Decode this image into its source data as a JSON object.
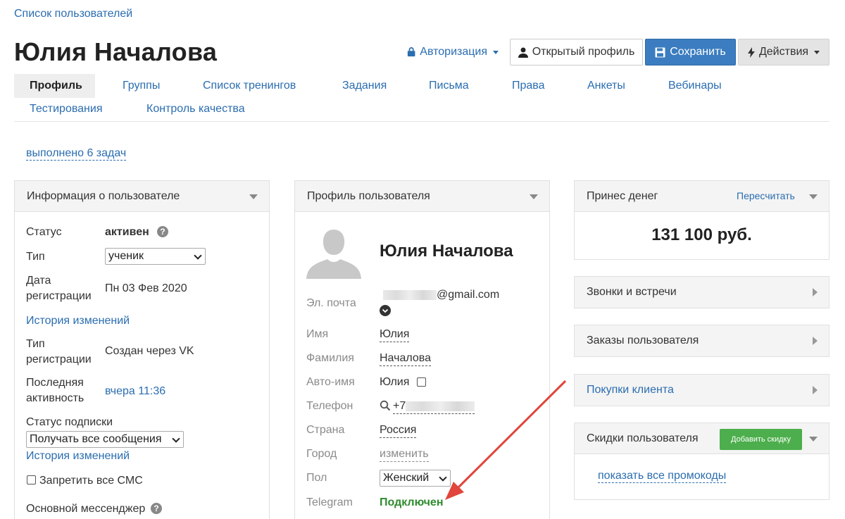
{
  "breadcrumb": "Список пользователей",
  "page_title": "Юлия Началова",
  "toolbar": {
    "auth_label": "Авторизация",
    "open_profile_label": "Открытый профиль",
    "save_label": "Сохранить",
    "actions_label": "Действия"
  },
  "tabs": [
    {
      "label": "Профиль",
      "active": true
    },
    {
      "label": "Группы"
    },
    {
      "label": "Список тренингов"
    },
    {
      "label": "Задания"
    },
    {
      "label": "Письма"
    },
    {
      "label": "Права"
    },
    {
      "label": "Анкеты"
    },
    {
      "label": "Вебинары"
    },
    {
      "label": "Тестирования"
    },
    {
      "label": "Контроль качества"
    }
  ],
  "tasks_link": "выполнено 6 задач",
  "user_info": {
    "title": "Информация о пользователе",
    "status_label": "Статус",
    "status_value": "активен",
    "type_label": "Тип",
    "type_value": "ученик",
    "reg_date_label_1": "Дата",
    "reg_date_label_2": "регистрации",
    "reg_date_value": "Пн 03 Фев 2020",
    "history_link_1": "История изменений",
    "reg_type_label_1": "Тип",
    "reg_type_label_2": "регистрации",
    "reg_type_value": "Создан через VK",
    "last_activity_label_1": "Последняя",
    "last_activity_label_2": "активность",
    "last_activity_value": "вчера 11:36",
    "subscription_label": "Статус подписки",
    "subscription_value": "Получать все сообщения",
    "history_link_2": "История изменений",
    "sms_label": "Запретить все СМС",
    "messenger_label": "Основной мессенджер"
  },
  "profile": {
    "title": "Профиль пользователя",
    "name": "Юлия Началова",
    "email_label": "Эл. почта",
    "email_suffix": "@gmail.com",
    "first_name_label": "Имя",
    "first_name_value": "Юлия",
    "last_name_label": "Фамилия",
    "last_name_value": "Началова",
    "auto_name_label": "Авто-имя",
    "auto_name_value": "Юлия",
    "phone_label": "Телефон",
    "phone_prefix": "+7",
    "country_label": "Страна",
    "country_value": "Россия",
    "city_label": "Город",
    "city_value": "изменить",
    "gender_label": "Пол",
    "gender_value": "Женский",
    "telegram_label": "Telegram",
    "telegram_value": "Подключен"
  },
  "money": {
    "title": "Принес денег",
    "recalc_label": "Пересчитать",
    "amount": "131 100 руб."
  },
  "side_panels": {
    "calls": "Звонки и встречи",
    "orders": "Заказы пользователя",
    "purchases": "Покупки клиента"
  },
  "discounts": {
    "title": "Скидки пользователя",
    "add_label": "Добавить скидку",
    "show_promos": "показать все промокоды"
  },
  "colors": {
    "link": "#2a6db0",
    "save_button": "#3b7dc0",
    "telegram_status": "#2e8b2e",
    "arrow": "#e0463b",
    "add_discount_button": "#4cae4c"
  }
}
